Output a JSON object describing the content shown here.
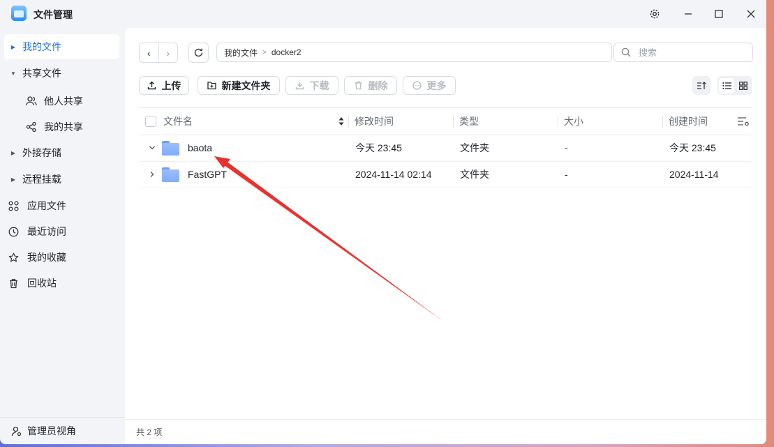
{
  "window": {
    "title": "文件管理"
  },
  "sidebar": {
    "items": [
      {
        "label": "我的文件"
      },
      {
        "label": "共享文件"
      },
      {
        "label": "他人共享"
      },
      {
        "label": "我的共享"
      },
      {
        "label": "外接存储"
      },
      {
        "label": "远程挂载"
      },
      {
        "label": "应用文件"
      },
      {
        "label": "最近访问"
      },
      {
        "label": "我的收藏"
      },
      {
        "label": "回收站"
      }
    ],
    "footer": "管理员视角"
  },
  "toolbar": {
    "breadcrumb": [
      "我的文件",
      "docker2"
    ],
    "search_placeholder": "搜索",
    "upload": "上传",
    "new_folder": "新建文件夹",
    "download": "下载",
    "delete": "删除",
    "more": "更多"
  },
  "table": {
    "columns": [
      "文件名",
      "修改时间",
      "类型",
      "大小",
      "创建时间"
    ],
    "rows": [
      {
        "name": "baota",
        "modified": "今天 23:45",
        "type": "文件夹",
        "size": "-",
        "created": "今天 23:45"
      },
      {
        "name": "FastGPT",
        "modified": "2024-11-14 02:14",
        "type": "文件夹",
        "size": "-",
        "created": "2024-11-14"
      }
    ]
  },
  "status": "共 2 项",
  "colors": {
    "accent": "#1f6fde",
    "annotation_arrow": "#e8322d"
  }
}
